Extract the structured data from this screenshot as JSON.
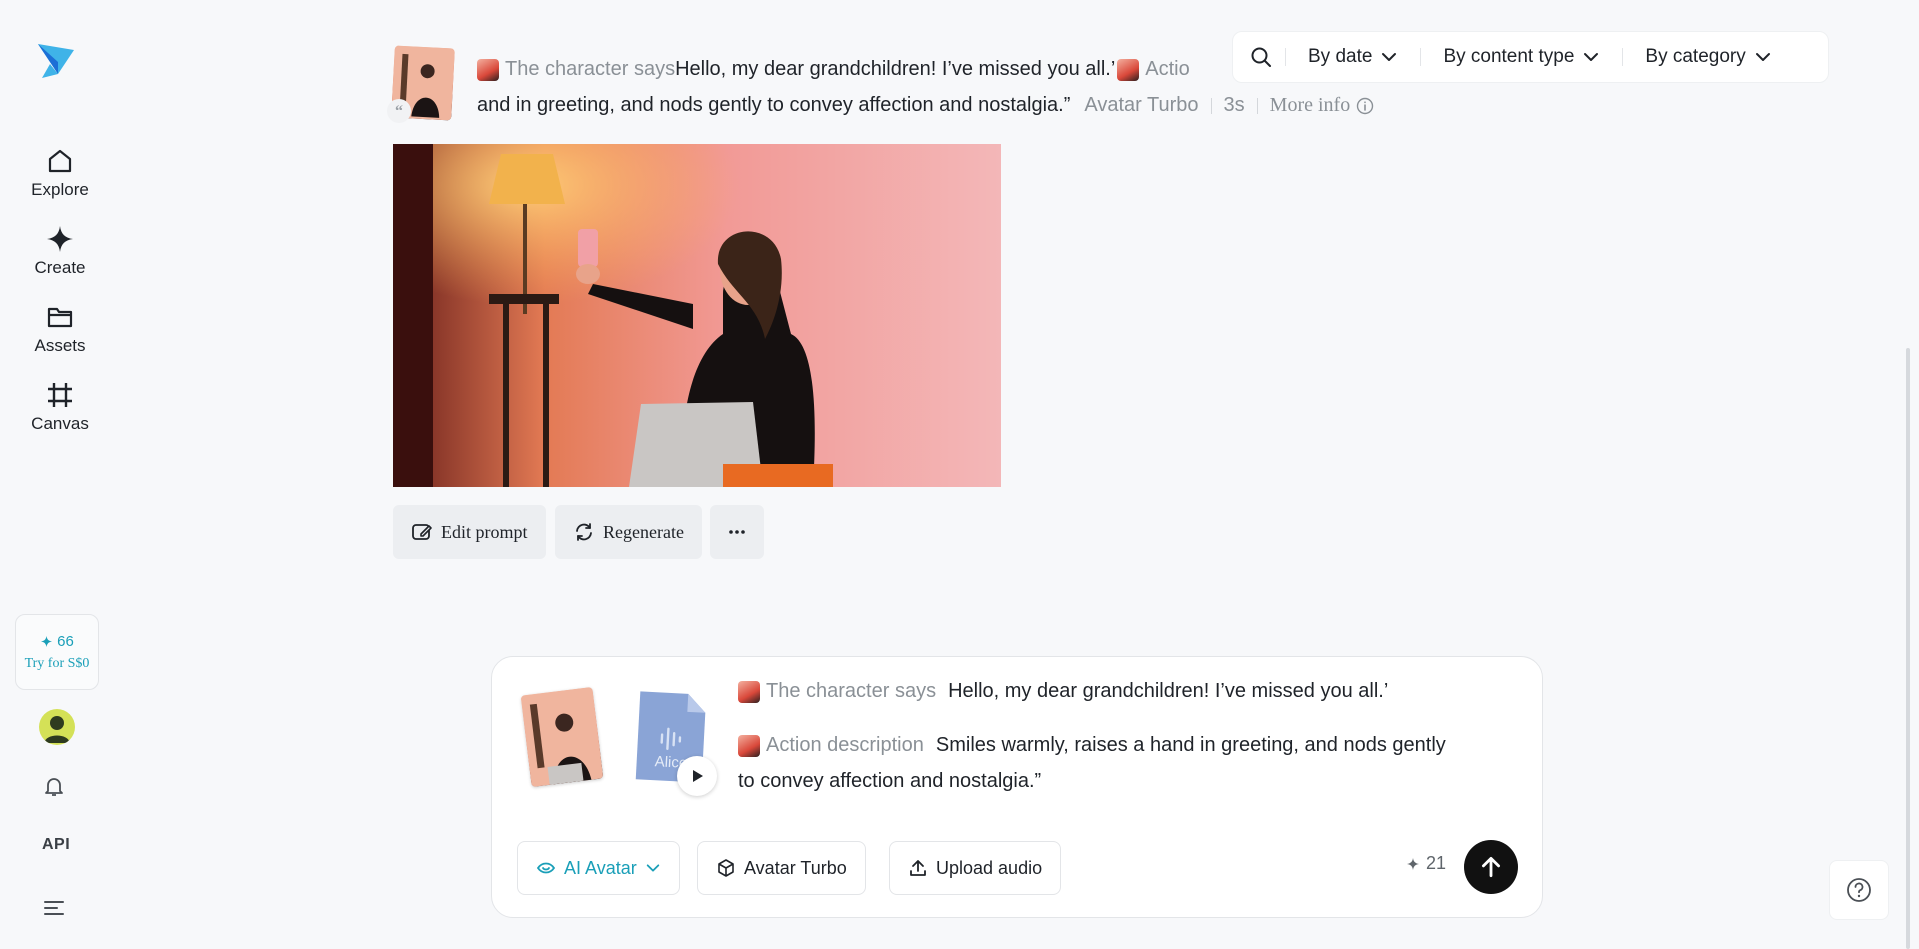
{
  "sidebar": {
    "logo": "brand-logo",
    "items": [
      {
        "label": "Explore",
        "icon": "home-icon"
      },
      {
        "label": "Create",
        "icon": "sparkle-icon"
      },
      {
        "label": "Assets",
        "icon": "folder-icon"
      },
      {
        "label": "Canvas",
        "icon": "canvas-icon"
      }
    ],
    "credits": {
      "count": "66",
      "try_label": "Try for S$0"
    },
    "api_label": "API"
  },
  "toolbar": {
    "filters": [
      {
        "label": "By date"
      },
      {
        "label": "By content type"
      },
      {
        "label": "By category"
      }
    ]
  },
  "record": {
    "says_tag": "The character says",
    "says_text": "Hello, my dear grandchildren! I’ve missed you all.’",
    "action_tag_partial": "Actio",
    "line2_text": "and in greeting, and nods gently to convey affection and nostalgia.”",
    "model": "Avatar Turbo",
    "duration": "3s",
    "more_info": "More info",
    "buttons": {
      "edit": "Edit prompt",
      "regenerate": "Regenerate"
    }
  },
  "composer": {
    "audio_name": "Alice",
    "says_tag": "The character says",
    "says_text": "Hello, my dear grandchildren! I’ve missed you all.’",
    "action_tag": "Action description",
    "action_text_line1": "Smiles warmly, raises a hand in greeting, and nods gently",
    "action_text_line2": "to convey affection and nostalgia.”",
    "mode": "AI Avatar",
    "model": "Avatar Turbo",
    "upload": "Upload audio",
    "cost": "21"
  },
  "colors": {
    "accent": "#1a9fb8",
    "send": "#111111"
  }
}
